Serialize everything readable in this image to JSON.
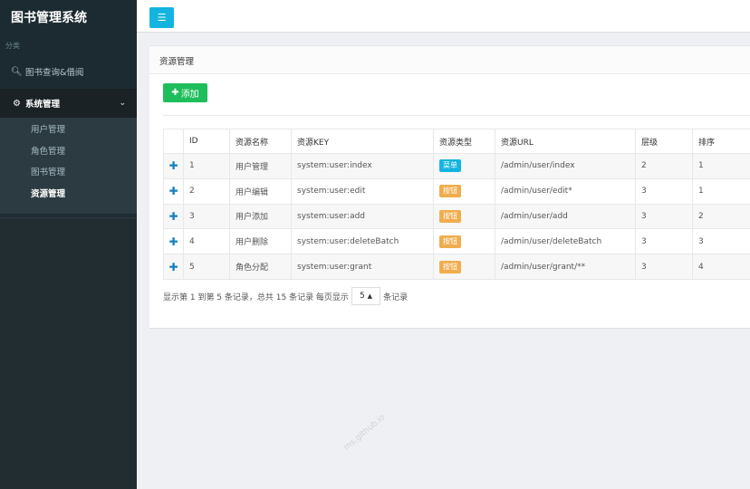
{
  "app": {
    "title": "图书管理系统"
  },
  "sidebar": {
    "section_label": "分类",
    "search_item": "图书查询&借阅",
    "group": {
      "label": "系统管理",
      "items": [
        {
          "label": "用户管理",
          "active": false
        },
        {
          "label": "角色管理",
          "active": false
        },
        {
          "label": "图书管理",
          "active": false
        },
        {
          "label": "资源管理",
          "active": true
        }
      ]
    }
  },
  "box": {
    "title": "资源管理",
    "add_label": "添加"
  },
  "table": {
    "headers": [
      "",
      "ID",
      "资源名称",
      "资源KEY",
      "资源类型",
      "资源URL",
      "层级",
      "排序"
    ],
    "rows": [
      {
        "id": "1",
        "name": "用户管理",
        "key": "system:user:index",
        "type": "菜单",
        "type_color": "#13b5e0",
        "url": "/admin/user/index",
        "level": "2",
        "sort": "1"
      },
      {
        "id": "2",
        "name": "用户编辑",
        "key": "system:user:edit",
        "type": "按钮",
        "type_color": "#f0ad4e",
        "url": "/admin/user/edit*",
        "level": "3",
        "sort": "1"
      },
      {
        "id": "3",
        "name": "用户添加",
        "key": "system:user:add",
        "type": "按钮",
        "type_color": "#f0ad4e",
        "url": "/admin/user/add",
        "level": "3",
        "sort": "2"
      },
      {
        "id": "4",
        "name": "用户删除",
        "key": "system:user:deleteBatch",
        "type": "按钮",
        "type_color": "#f0ad4e",
        "url": "/admin/user/deleteBatch",
        "level": "3",
        "sort": "3"
      },
      {
        "id": "5",
        "name": "角色分配",
        "key": "system:user:grant",
        "type": "按钮",
        "type_color": "#f0ad4e",
        "url": "/admin/user/grant/**",
        "level": "3",
        "sort": "4"
      }
    ]
  },
  "pager": {
    "summary": "显示第 1 到第 5 条记录，总共 15 条记录 每页显示",
    "page_size": "5",
    "suffix": "条记录"
  },
  "watermark": "ms.github.io"
}
